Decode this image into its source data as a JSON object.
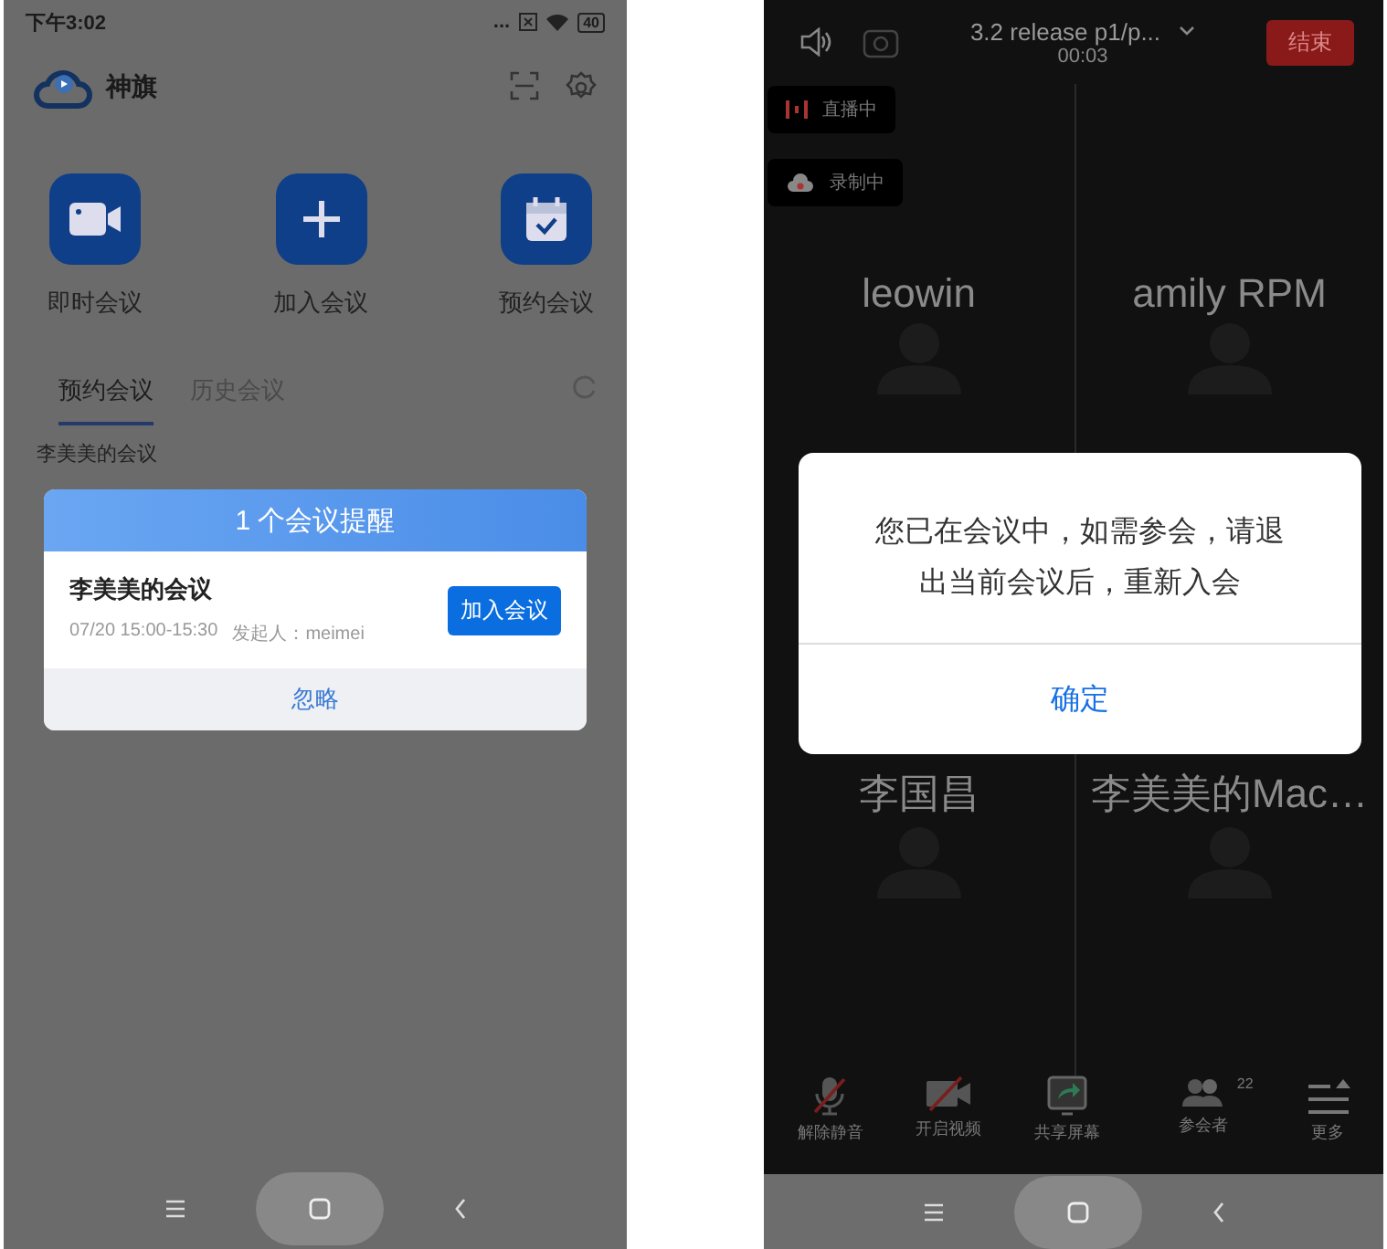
{
  "home_screen": {
    "status_bar": {
      "time": "下午3:02",
      "dots": "...",
      "battery": "40"
    },
    "app_title": "神旗",
    "actions": [
      {
        "kind": "video",
        "label": "即时会议"
      },
      {
        "kind": "join",
        "label": "加入会议"
      },
      {
        "kind": "schedule",
        "label": "预约会议"
      }
    ],
    "tabs": [
      {
        "label": "预约会议",
        "selected": true
      },
      {
        "label": "历史会议",
        "selected": false
      }
    ],
    "list_items": [
      "李美美的会议"
    ],
    "reminder": {
      "title": "1 个会议提醒",
      "meeting_name": "李美美的会议",
      "time": "07/20 15:00-15:30",
      "organizer": "发起人：meimei",
      "join_button": "加入会议",
      "ignore_button": "忽略"
    }
  },
  "meeting_screen": {
    "title": "3.2 release p1/p...",
    "timer": "00:03",
    "end_button": "结束",
    "badges": [
      {
        "kind": "live",
        "label": "直播中"
      },
      {
        "kind": "recording",
        "label": "录制中"
      }
    ],
    "participants": [
      "leowin",
      "amily RPM",
      "李国昌",
      "李美美的Mac…"
    ],
    "dialog": {
      "message": "您已在会议中，如需参会，请退出当前会议后，重新入会",
      "confirm_button": "确定"
    },
    "toolbar": [
      {
        "kind": "mic",
        "label": "解除静音"
      },
      {
        "kind": "camera",
        "label": "开启视频"
      },
      {
        "kind": "share",
        "label": "共享屏幕"
      },
      {
        "kind": "people",
        "label": "参会者",
        "count": "22"
      },
      {
        "kind": "more",
        "label": "更多"
      }
    ]
  }
}
